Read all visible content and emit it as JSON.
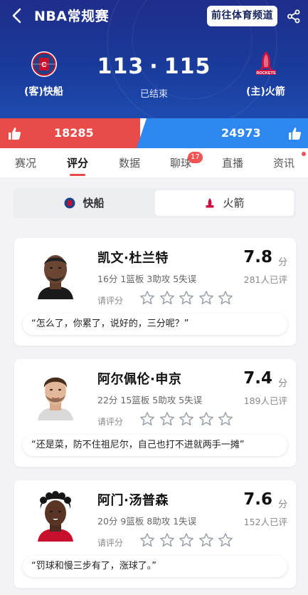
{
  "header": {
    "title": "NBA常规赛",
    "channel_button": "前往体育频道",
    "away_team": "(客)快船",
    "home_team": "(主)火箭",
    "away_score": "113",
    "separator": "·",
    "home_score": "115",
    "status": "已结束",
    "away_logo_text": "LA C",
    "home_logo_text": "ROCKETS"
  },
  "votes": {
    "away": "18285",
    "home": "24973"
  },
  "tabs": [
    {
      "label": "赛况"
    },
    {
      "label": "评分",
      "active": true
    },
    {
      "label": "数据"
    },
    {
      "label": "聊球",
      "badge": "17"
    },
    {
      "label": "直播"
    },
    {
      "label": "资讯",
      "dot": true
    }
  ],
  "team_toggle": {
    "away": "快船",
    "home": "火箭",
    "selected": "away"
  },
  "players": [
    {
      "name": "凯文·杜兰特",
      "stats": "16分 1篮板 3助攻 5失误",
      "rate_label": "请评分",
      "score": "7.8",
      "score_unit": "分",
      "raters": "281人已评",
      "stars_filled": 0,
      "quote": "“怎么了，你累了，说好的，三分呢？”",
      "skin": "#6a4532",
      "hair": "#222"
    },
    {
      "name": "阿尔佩伦·申京",
      "stats": "22分 15篮板 5助攻 5失误",
      "rate_label": "请评分",
      "score": "7.4",
      "score_unit": "分",
      "raters": "189人已评",
      "stars_filled": 0,
      "quote": "“还是菜，防不住祖尼尔，自己也打不进就两手一摊”",
      "skin": "#e3b79a",
      "hair": "#4a2e1c"
    },
    {
      "name": "阿门·汤普森",
      "stats": "20分 9篮板 8助攻 1失误",
      "rate_label": "请评分",
      "score": "7.6",
      "score_unit": "分",
      "raters": "152人已评",
      "stars_filled": 0,
      "quote": "“罚球和慢三步有了，涨球了。”",
      "skin": "#5a3424",
      "hair": "#151515"
    }
  ],
  "colors": {
    "header_bg": "#1f2d8a",
    "vote_red": "#e94b49",
    "vote_blue": "#2e86f0",
    "badge_red": "#f05454"
  }
}
